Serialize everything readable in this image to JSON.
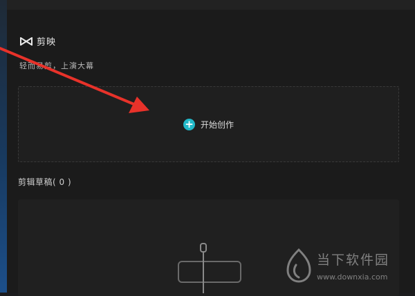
{
  "app": {
    "brand_name": "剪映",
    "slogan": "轻而易剪，上演大幕"
  },
  "create": {
    "label": "开始创作",
    "icon": "plus-icon",
    "accent_color": "#22b9c9"
  },
  "drafts": {
    "title": "剪辑草稿( 0 )"
  },
  "annotation": {
    "arrow_color": "#e8322a"
  },
  "watermark": {
    "title": "当下软件园",
    "url": "www.downxia.com"
  }
}
